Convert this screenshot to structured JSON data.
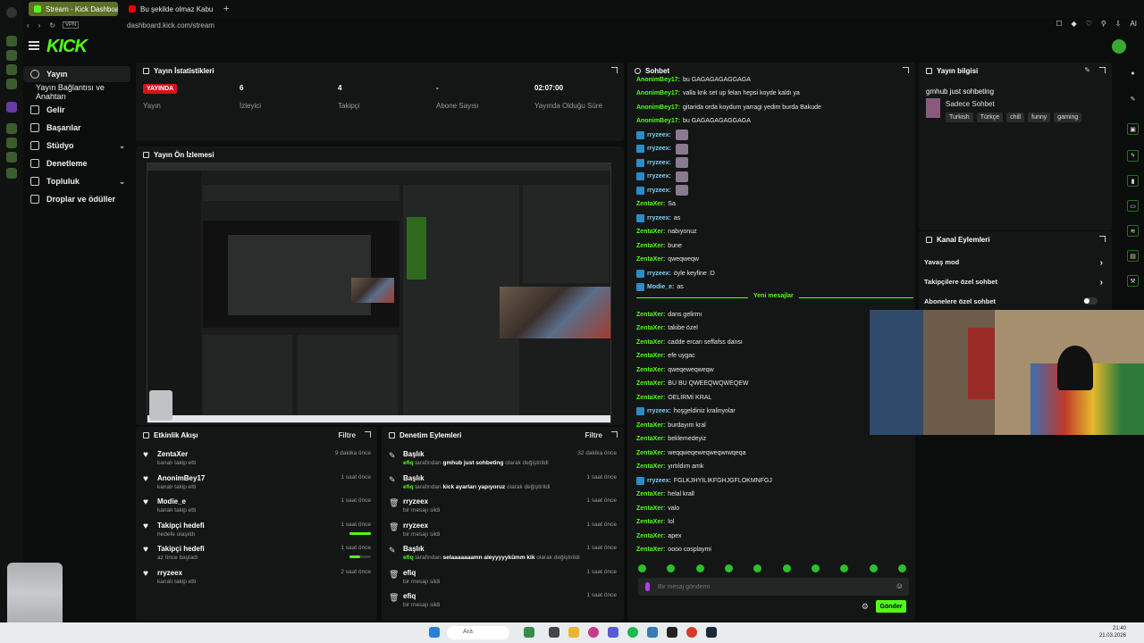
{
  "browser": {
    "tabs": [
      {
        "label": "Stream - Kick Dashboard"
      },
      {
        "label": "Bu şekilde olmaz Kabul e..."
      }
    ],
    "vpn": "VPN",
    "url": "dashboard.kick.com/stream",
    "ai": "AI"
  },
  "logo": "KICK",
  "sidebar": {
    "items": [
      {
        "label": "Yayın"
      },
      {
        "label": "Yayın Bağlantısı ve Anahtarı"
      },
      {
        "label": "Gelir"
      },
      {
        "label": "Başarılar"
      },
      {
        "label": "Stüdyo"
      },
      {
        "label": "Denetleme"
      },
      {
        "label": "Topluluk"
      },
      {
        "label": "Droplar ve ödüller"
      }
    ]
  },
  "stats": {
    "title": "Yayın İstatistikleri",
    "live_badge": "YAYINDA",
    "items": [
      {
        "value": "",
        "label": "Yayın"
      },
      {
        "value": "6",
        "label": "İzleyici"
      },
      {
        "value": "4",
        "label": "Takipçi"
      },
      {
        "value": "-",
        "label": "Abone Sayısı"
      },
      {
        "value": "02:07:00",
        "label": "Yayında Olduğu Süre"
      }
    ]
  },
  "preview": {
    "title": "Yayın Ön İzlemesi"
  },
  "activity": {
    "title": "Etkinlik Akışı",
    "filter": "Filtre",
    "rows": [
      {
        "title": "ZentaXer",
        "sub": "kanalı takip etti",
        "time": "9 dakika önce",
        "progress": null
      },
      {
        "title": "AnonimBey17",
        "sub": "kanalı takip etti",
        "time": "1 saat önce",
        "progress": null
      },
      {
        "title": "Modie_e",
        "sub": "kanalı takip etti",
        "time": "1 saat önce",
        "progress": null
      },
      {
        "title": "Takipçi hedefi",
        "sub": "hedefe ulaşıldı",
        "time": "1 saat önce",
        "progress": 1.0
      },
      {
        "title": "Takipçi hedefi",
        "sub": "az önce başladı",
        "time": "1 saat önce",
        "progress": 0.5
      },
      {
        "title": "rryzeex",
        "sub": "kanalı takip etti",
        "time": "2 saat önce",
        "progress": null
      }
    ]
  },
  "moderation": {
    "title": "Denetim Eylemleri",
    "filter": "Filtre",
    "rows": [
      {
        "title": "Başlık",
        "who": "efiq",
        "mid": "tarafından",
        "value": "gmhub just sohbeting",
        "end": "olarak değiştirildi",
        "time": "32 dakika önce"
      },
      {
        "title": "Başlık",
        "who": "efiq",
        "mid": "tarafından",
        "value": "kick ayarları yapıyoruz",
        "end": "olarak değiştirildi",
        "time": "1 saat önce"
      },
      {
        "title": "rryzeex",
        "sub": "bir mesajı sildi",
        "time": "1 saat önce"
      },
      {
        "title": "rryzeex",
        "sub": "bir mesajı sildi",
        "time": "1 saat önce"
      },
      {
        "title": "Başlık",
        "who": "efiq",
        "mid": "tarafından",
        "value": "selaaaaaaamn aleyyyyykümm kik",
        "end": "olarak değiştirildi",
        "time": "1 saat önce"
      },
      {
        "title": "efiq",
        "sub": "bir mesajı sildi",
        "time": "1 saat önce"
      },
      {
        "title": "efiq",
        "sub": "bir mesajı sildi",
        "time": "1 saat önce"
      }
    ]
  },
  "chat": {
    "title": "Sohbet",
    "new_messages": "Yeni mesajlar",
    "placeholder": "Bir mesaj gönderin",
    "send": "Gönder",
    "lines": [
      {
        "user": "AnonimBey17:",
        "text": "bu GAGAGAGAGGAGA",
        "badge": false,
        "emotes": 0
      },
      {
        "user": "AnonimBey17:",
        "text": "valla knk set up felan hepsi koyde kaldı ya",
        "badge": false,
        "emotes": 0
      },
      {
        "user": "AnonimBey17:",
        "text": "gitarida orda koydum yarragi yedim burda Bakude",
        "badge": false,
        "emotes": 0
      },
      {
        "user": "AnonimBey17:",
        "text": "bu GAGAGAGAGGAGA",
        "badge": false,
        "emotes": 0
      },
      {
        "user": "rryzeex:",
        "text": "",
        "badge": true,
        "emotes": 1
      },
      {
        "user": "rryzeex:",
        "text": "",
        "badge": true,
        "emotes": 1
      },
      {
        "user": "rryzeex:",
        "text": "",
        "badge": true,
        "emotes": 1
      },
      {
        "user": "rryzeex:",
        "text": "",
        "badge": true,
        "emotes": 1
      },
      {
        "user": "rryzeex:",
        "text": "",
        "badge": true,
        "emotes": 1
      },
      {
        "user": "ZentaXer:",
        "text": "Sa",
        "badge": false,
        "emotes": 0
      },
      {
        "user": "rryzeex:",
        "text": "as",
        "badge": true,
        "emotes": 0
      },
      {
        "user": "ZentaXer:",
        "text": "nabıyonuz",
        "badge": false,
        "emotes": 0
      },
      {
        "user": "ZentaXer:",
        "text": "bune",
        "badge": false,
        "emotes": 0
      },
      {
        "user": "ZentaXer:",
        "text": "qweqweqw",
        "badge": false,
        "emotes": 0
      },
      {
        "user": "rryzeex:",
        "text": "öyle keyfine :D",
        "badge": true,
        "emotes": 0
      },
      {
        "user": "Modie_e:",
        "text": "as",
        "badge": true,
        "emotes": 0
      }
    ],
    "lines_after": [
      {
        "user": "ZentaXer:",
        "text": "dans gelirmı",
        "badge": false
      },
      {
        "user": "ZentaXer:",
        "text": "takibe özel",
        "badge": false
      },
      {
        "user": "ZentaXer:",
        "text": "cadde ercan seffafss dansı",
        "badge": false
      },
      {
        "user": "ZentaXer:",
        "text": "efe uygac",
        "badge": false
      },
      {
        "user": "ZentaXer:",
        "text": "qweqeweqweqw",
        "badge": false
      },
      {
        "user": "ZentaXer:",
        "text": "BU BU QWEEQWQWEQEW",
        "badge": false
      },
      {
        "user": "ZentaXer:",
        "text": "OELİRMİ KRAL",
        "badge": false
      },
      {
        "user": "rryzeex:",
        "text": "hoşgeldiniz kralinyolar",
        "badge": true
      },
      {
        "user": "ZentaXer:",
        "text": "burdayım kral",
        "badge": false
      },
      {
        "user": "ZentaXer:",
        "text": "beklemedeyiz",
        "badge": false
      },
      {
        "user": "ZentaXer:",
        "text": "weqqweqeweqweqwrwqeqa",
        "badge": false
      },
      {
        "user": "ZentaXer:",
        "text": "yırtıldım amk",
        "badge": false
      },
      {
        "user": "rryzeex:",
        "text": "FGLKJHYILIKFGHJGFLOKMNFGJ",
        "badge": true
      },
      {
        "user": "ZentaXer:",
        "text": "helal krall",
        "badge": false
      },
      {
        "user": "ZentaXer:",
        "text": "valo",
        "badge": false
      },
      {
        "user": "ZentaXer:",
        "text": "lol",
        "badge": false
      },
      {
        "user": "ZentaXer:",
        "text": "apex",
        "badge": false
      },
      {
        "user": "ZentaXer:",
        "text": "oooo cosplaymi",
        "badge": false
      }
    ]
  },
  "info": {
    "title": "Yayın bilgisi",
    "stream_title": "gmhub just sohbeting",
    "category": "Sadece Sohbet",
    "tags": [
      "Turkish",
      "Türkçe",
      "chill",
      "funny",
      "gaming"
    ]
  },
  "channel_actions": {
    "title": "Kanal Eylemleri",
    "items": [
      {
        "label": "Yavaş mod"
      },
      {
        "label": "Takipçilere özel sohbet"
      },
      {
        "label": "Abonelere özel sohbet"
      }
    ]
  },
  "taskbar": {
    "search": "Ara",
    "time": "21:40",
    "date": "21.03.2026"
  }
}
